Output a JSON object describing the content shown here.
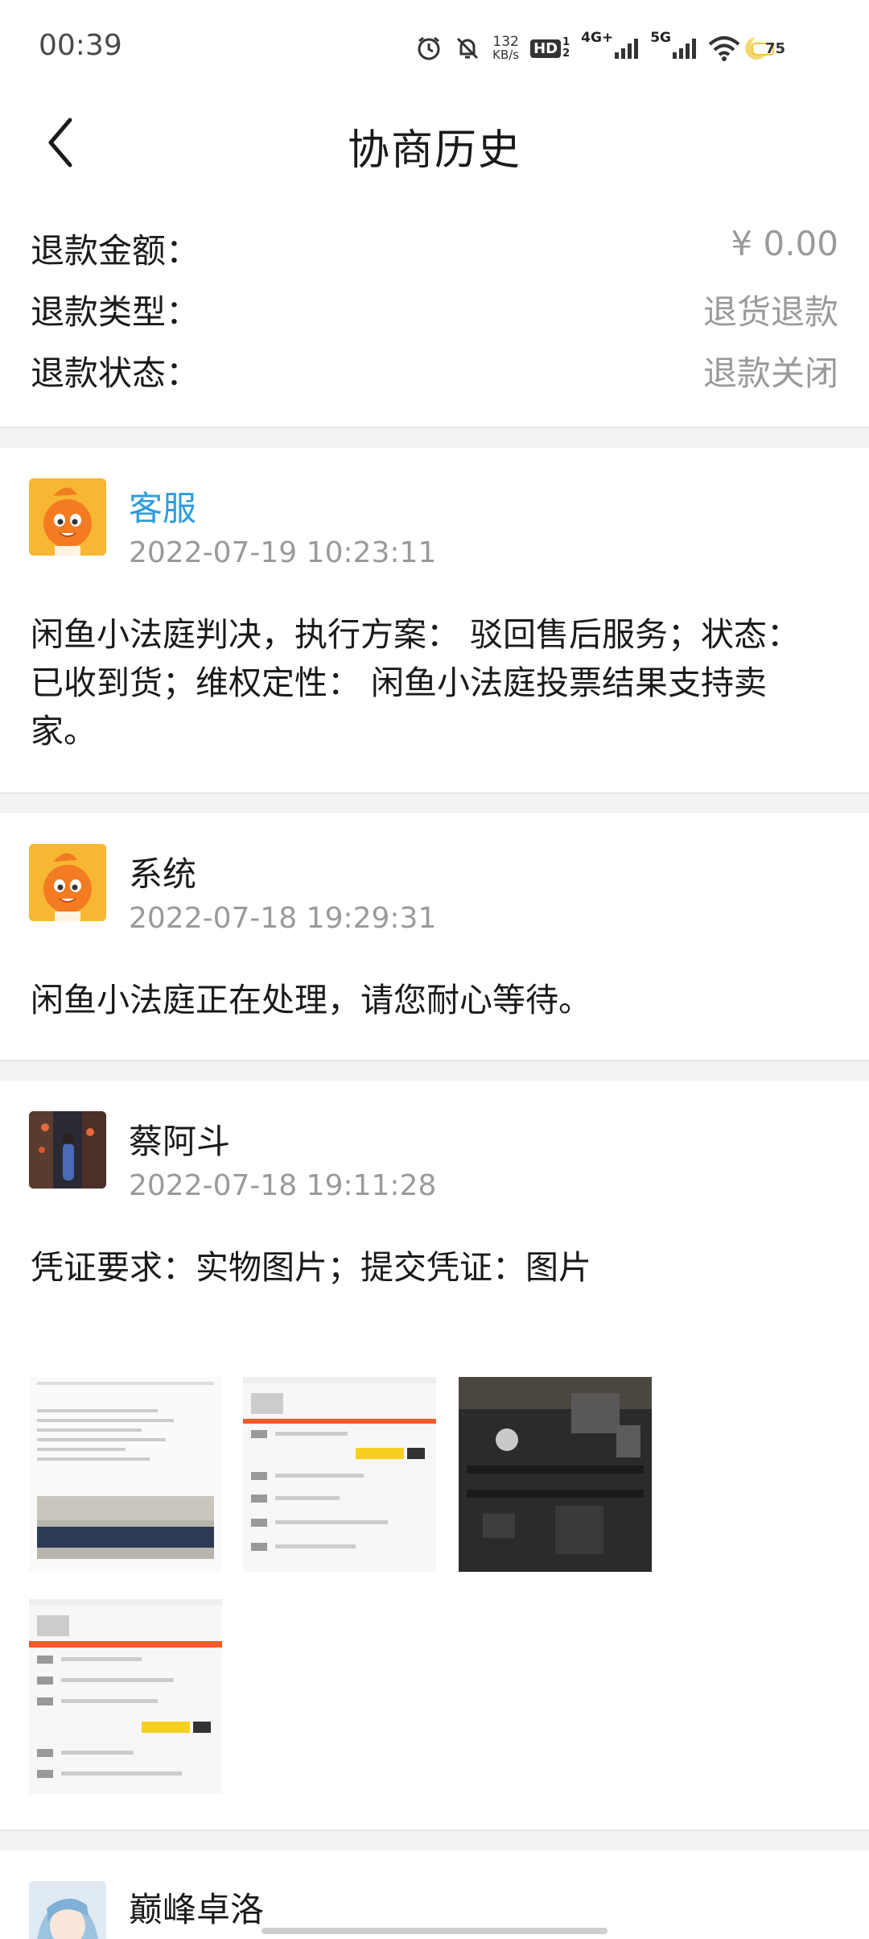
{
  "status_bar": {
    "time": "00:39",
    "net_speed_value": "132",
    "net_speed_unit": "KB/s",
    "hd_label": "HD",
    "hd_sub_top": "1",
    "hd_sub_bottom": "2",
    "network_4g": "4G+",
    "network_5g": "5G",
    "battery": "75"
  },
  "header": {
    "title": "协商历史",
    "back_icon": "chevron-left-icon"
  },
  "summary": {
    "rows": [
      {
        "label": "退款金额：",
        "value": "¥ 0.00"
      },
      {
        "label": "退款类型：",
        "value": "退货退款"
      },
      {
        "label": "退款状态：",
        "value": "退款关闭"
      }
    ]
  },
  "history": [
    {
      "name": "客服",
      "name_color": "#2d9cdb",
      "time": "2022-07-19 10:23:11",
      "lines": [
        "闲鱼小法庭判决，执行方案： 驳回售后服务；状态：",
        "已收到货；维权定性：   闲鱼小法庭投票结果支持卖",
        "家。"
      ]
    },
    {
      "name": "系统",
      "time": "2022-07-18 19:29:31",
      "lines": [
        "闲鱼小法庭正在处理，请您耐心等待。"
      ]
    },
    {
      "name": "蔡阿斗",
      "time": "2022-07-18 19:11:28",
      "lines": [
        "凭证要求：实物图片；提交凭证：图片"
      ],
      "attachments": [
        "screenshot-thumbnail",
        "chat-screenshot-thumbnail",
        "motherboard-photo-thumbnail",
        "chat-screenshot-thumbnail"
      ]
    },
    {
      "name": "巅峰卓洛"
    }
  ],
  "colors": {
    "accent_blue": "#2d9cdb",
    "muted_text": "#9a9a9a",
    "divider": "#f2f2f2",
    "orange_header": "#f25a29"
  }
}
